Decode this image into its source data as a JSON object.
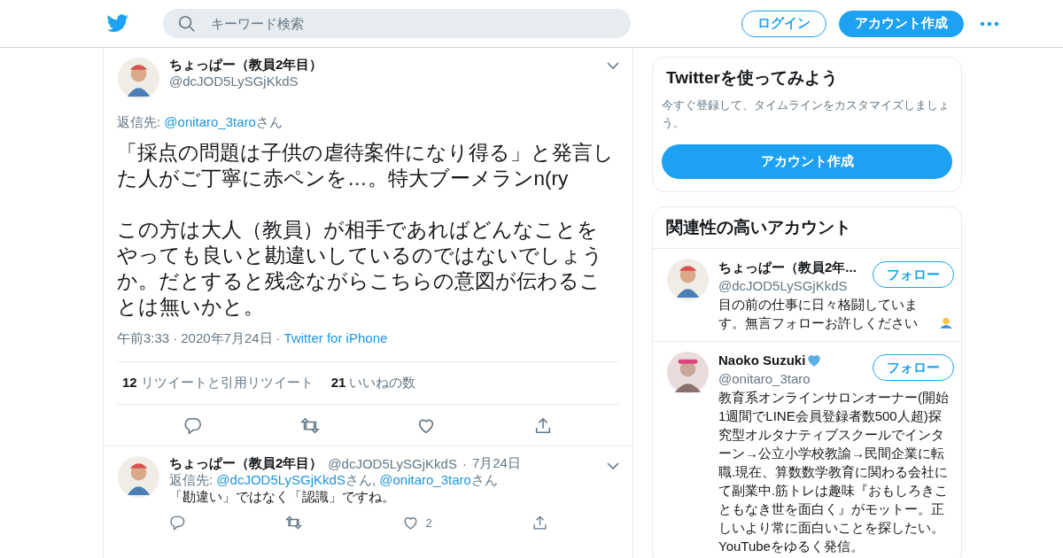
{
  "header": {
    "search": {
      "placeholder": "キーワード検索"
    },
    "buttons": [
      {
        "label": "ログイン",
        "kind": "outline"
      },
      {
        "label": "アカウント作成",
        "kind": "filled"
      }
    ]
  },
  "tweet": {
    "name": "ちょっぱー（教員2年目）",
    "handle": "@dcJOD5LySGjKkdS",
    "reply_prefix": "返信先:",
    "reply_to": [
      {
        "handle": "@onitaro_3taro",
        "suffix": "さん"
      }
    ],
    "paragraphs": [
      "「採点の問題は子供の虐待案件になり得る」と発言した人がご丁寧に赤ペンを…。特大ブーメランn(ry",
      "この方は大人（教員）が相手であればどんなことをやっても良いと勘違いしているのではないでしょうか。だとすると残念ながらこちらの意図が伝わることは無いかと。"
    ],
    "time": "午前3:33",
    "separator": "·",
    "date": "2020年7月24日",
    "source": "Twitter for iPhone",
    "stats": [
      {
        "count": "12",
        "label": "リツイートと引用リツイート"
      },
      {
        "count": "21",
        "label": "いいねの数"
      }
    ]
  },
  "replies": [
    {
      "name": "ちょっぱー（教員2年目）",
      "handle": "@dcJOD5LySGjKkdS",
      "separator": "·",
      "date": "7月24日",
      "reply_prefix": "返信先:",
      "reply_to": [
        {
          "handle": "@dcJOD5LySGjKkdS",
          "suffix": "さん,"
        },
        {
          "handle": "@onitaro_3taro",
          "suffix": "さん"
        }
      ],
      "text": "「勘違い」ではなく「認識」ですね。",
      "likes": "2"
    }
  ],
  "signup": {
    "title": "Twitterを使ってみよう",
    "text": "今すぐ登録して、タイムラインをカスタマイズしましょう。",
    "button": "アカウント作成"
  },
  "related": {
    "title": "関連性の高いアカウント",
    "accounts": [
      {
        "name": "ちょっぱー（教員2年...",
        "handle": "@dcJOD5LySGjKkdS",
        "button": "フォロー",
        "bio": "目の前の仕事に日々格闘しています。無言フォローお許しください",
        "kind": "bow"
      },
      {
        "name": "Naoko Suzuki",
        "handle": "@onitaro_3taro",
        "button": "フォロー",
        "bio": "教育系オンラインサロンオーナー(開始1週間でLINE会員登録者数500人超)探究型オルタナティブスクールでインターン→公立小学校教諭→民間企業に転職.現在、算数数学教育に関わる会社にて副業中.筋トレは趣味『おもしろきこともなき世を面白く』がモットー。正しいより常に面白いことを探したい。YouTubeをゆるく発信。",
        "kind": "heart"
      }
    ]
  }
}
